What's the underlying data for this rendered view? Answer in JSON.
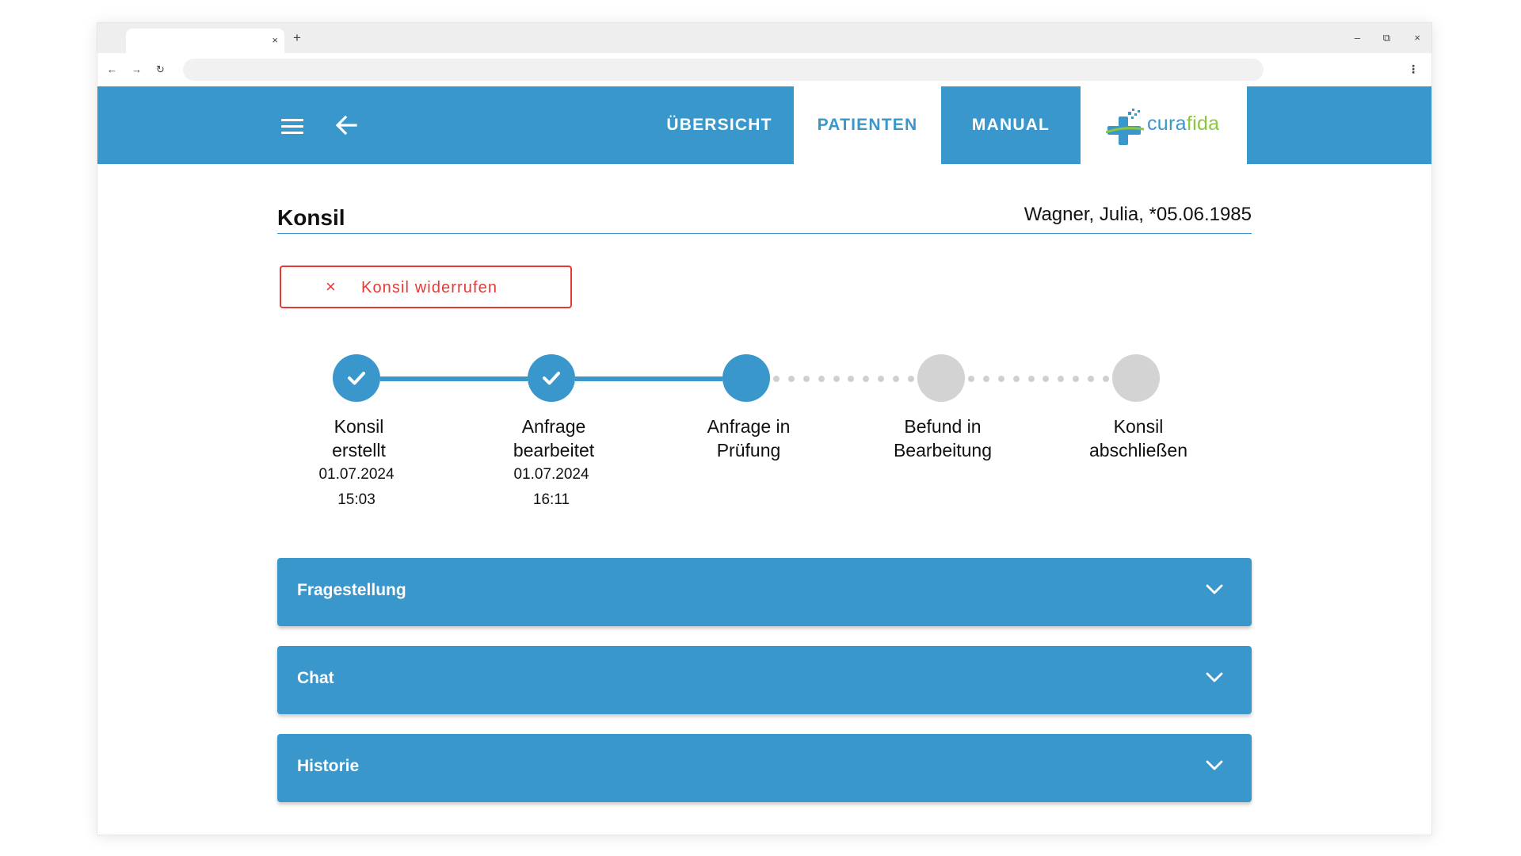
{
  "browser": {
    "tab_close": "×",
    "new_tab": "+",
    "minimize": "–",
    "restore": "⧉",
    "close": "×",
    "nav_back": "←",
    "nav_forward": "→",
    "reload": "↻",
    "menu": "⋮"
  },
  "nav": {
    "tabs": [
      {
        "label": "ÜBERSICHT",
        "active": false
      },
      {
        "label": "PATIENTEN",
        "active": true
      },
      {
        "label": "MANUAL",
        "active": false
      }
    ],
    "logo": {
      "part1": "cura",
      "part2": "fida"
    }
  },
  "colors": {
    "primary": "#3a97cb",
    "danger": "#e53935",
    "pending": "#d3d3d3",
    "logo_green": "#8cc63f"
  },
  "page": {
    "title": "Konsil",
    "patient": "Wagner, Julia, *05.06.1985",
    "revoke_button": "Konsil widerrufen",
    "revoke_icon": "×"
  },
  "steps": [
    {
      "label_line1": "Konsil",
      "label_line2": "erstellt",
      "date": "01.07.2024",
      "time": "15:03",
      "status": "done"
    },
    {
      "label_line1": "Anfrage",
      "label_line2": "bearbeitet",
      "date": "01.07.2024",
      "time": "16:11",
      "status": "done"
    },
    {
      "label_line1": "Anfrage in",
      "label_line2": "Prüfung",
      "status": "current"
    },
    {
      "label_line1": "Befund in",
      "label_line2": "Bearbeitung",
      "status": "pending"
    },
    {
      "label_line1": "Konsil",
      "label_line2": "abschließen",
      "status": "pending"
    }
  ],
  "panels": [
    {
      "title": "Fragestellung"
    },
    {
      "title": "Chat"
    },
    {
      "title": "Historie"
    }
  ]
}
